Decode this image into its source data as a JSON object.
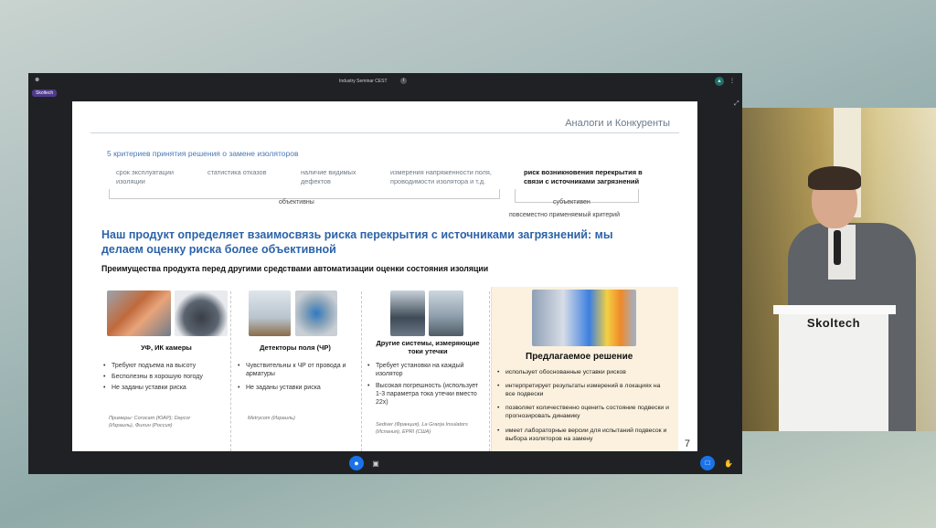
{
  "window": {
    "title": "Industry Seminar CEST",
    "tag": "Skoltech"
  },
  "room": {
    "lectern_label": "Skoltech"
  },
  "slide": {
    "title": "Аналоги и Конкуренты",
    "criteria_title": "5 критериев принятия решения о замене изоляторов",
    "criteria": [
      "срок эксплуатации изоляции",
      "статистика отказов",
      "наличие видимых дефектов",
      "измерения напряженности поля, проводимости изолятора и т.д."
    ],
    "criteria_bold": "риск возникновения перекрытия в связи с источниками загрязнений",
    "label_objective": "объективны",
    "label_subjective": "субъективен",
    "label_common": "повсеместно применяемый критерий",
    "headline": "Наш продукт определяет взаимосвязь риска перекрытия с источниками загрязнений: мы делаем оценку риска более объективной",
    "subhead": "Преимущества продукта перед другими средствами автоматизации оценки состояния изоляции",
    "columns": [
      {
        "title": "УФ, ИК камеры",
        "bullets": [
          "Требуют подъема на высоту",
          "Бесполезны в хорошую погоду",
          "Не заданы уставки риска"
        ],
        "examples": "Примеры: Corocam (ЮАР); Daycor (Израиль), Филин (Россия)"
      },
      {
        "title": "Детекторы поля (ЧР)",
        "bullets": [
          "Чувствительны к ЧР от провода и арматуры",
          "Не заданы уставки риска"
        ],
        "examples": "Metrycom (Израиль)"
      },
      {
        "title": "Другие системы, измеряющие токи утечки",
        "bullets": [
          "Требует установки на каждый изолятор",
          "Высокая погрешность (использует 1-3 параметра тока утечки вместо 22х)"
        ],
        "examples": "Sediver (Франция), La Granja Insulators (Испания), EPRI (США)"
      }
    ],
    "proposed": {
      "title": "Предлагаемое решение",
      "bullets": [
        "использует обоснованные уставки рисков",
        "интерпретирует результаты измерений в локациях на все подвески",
        "позволяет количественно оценить состояние подвески и прогнозировать динамику",
        "имеет лабораторные версии для испытаний подвесок и выбора изоляторов на замену"
      ]
    },
    "page_number": "7"
  },
  "icons": [
    "people-icon",
    "info-icon",
    "more-icon",
    "expand-icon",
    "mic-icon",
    "camera-icon",
    "chat-icon",
    "hand-icon"
  ]
}
